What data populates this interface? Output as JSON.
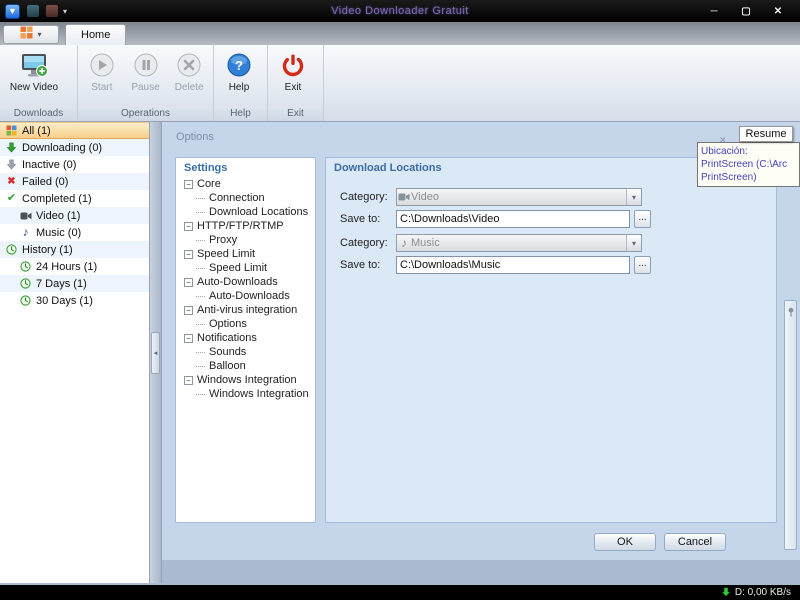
{
  "window": {
    "title": "Video Downloader Gratuit"
  },
  "ribbon": {
    "home_tab": "Home",
    "groups": [
      {
        "label": "Downloads",
        "buttons": [
          {
            "label": "New Video",
            "icon": "new-video-monitor-icon",
            "enabled": true
          }
        ]
      },
      {
        "label": "Operations",
        "buttons": [
          {
            "label": "Start",
            "icon": "play-circle-icon",
            "enabled": false
          },
          {
            "label": "Pause",
            "icon": "pause-circle-icon",
            "enabled": false
          },
          {
            "label": "Delete",
            "icon": "delete-circle-icon",
            "enabled": false
          }
        ]
      },
      {
        "label": "Help",
        "buttons": [
          {
            "label": "Help",
            "icon": "help-circle-icon",
            "enabled": true
          }
        ]
      },
      {
        "label": "Exit",
        "buttons": [
          {
            "label": "Exit",
            "icon": "power-icon",
            "enabled": true
          }
        ]
      }
    ]
  },
  "sidebar": {
    "items": [
      {
        "label": "All (1)",
        "icon": "categories-grid-icon",
        "indent": 0,
        "selected": true
      },
      {
        "label": "Downloading (0)",
        "icon": "download-arrow-green-icon",
        "indent": 0
      },
      {
        "label": "Inactive (0)",
        "icon": "download-arrow-gray-icon",
        "indent": 0
      },
      {
        "label": "Failed (0)",
        "icon": "failed-x-icon",
        "indent": 0
      },
      {
        "label": "Completed (1)",
        "icon": "completed-check-icon",
        "indent": 0
      },
      {
        "label": "Video (1)",
        "icon": "video-camera-icon",
        "indent": 1
      },
      {
        "label": "Music (0)",
        "icon": "music-note-icon",
        "indent": 1
      },
      {
        "label": "History (1)",
        "icon": "history-clock-icon",
        "indent": 0
      },
      {
        "label": "24 Hours (1)",
        "icon": "clock-icon",
        "indent": 1
      },
      {
        "label": "7 Days (1)",
        "icon": "clock-icon",
        "indent": 1
      },
      {
        "label": "30 Days (1)",
        "icon": "clock-icon",
        "indent": 1
      }
    ]
  },
  "options": {
    "panel_title": "Options",
    "settings": {
      "group_title": "Settings",
      "tree": [
        {
          "label": "Core",
          "level": 0
        },
        {
          "label": "Connection",
          "level": 1
        },
        {
          "label": "Download Locations",
          "level": 1
        },
        {
          "label": "HTTP/FTP/RTMP",
          "level": 0
        },
        {
          "label": "Proxy",
          "level": 1
        },
        {
          "label": "Speed Limit",
          "level": 0
        },
        {
          "label": "Speed Limit",
          "level": 1
        },
        {
          "label": "Auto-Downloads",
          "level": 0
        },
        {
          "label": "Auto-Downloads",
          "level": 1
        },
        {
          "label": "Anti-virus integration",
          "level": 0
        },
        {
          "label": "Options",
          "level": 1
        },
        {
          "label": "Notifications",
          "level": 0
        },
        {
          "label": "Sounds",
          "level": 1
        },
        {
          "label": "Balloon",
          "level": 1
        },
        {
          "label": "Windows Integration",
          "level": 0
        },
        {
          "label": "Windows Integration",
          "level": 1
        }
      ]
    },
    "download_locations": {
      "group_title": "Download Locations",
      "rows": [
        {
          "category_label": "Category:",
          "category_value": "Video",
          "category_icon": "video-camera-icon",
          "save_label": "Save to:",
          "save_value": "C:\\Downloads\\Video",
          "browse_label": "..."
        },
        {
          "category_label": "Category:",
          "category_value": "Music",
          "category_icon": "music-note-icon",
          "save_label": "Save to:",
          "save_value": "C:\\Downloads\\Music",
          "browse_label": "..."
        }
      ]
    },
    "ok_label": "OK",
    "cancel_label": "Cancel"
  },
  "overlay": {
    "resume_label": "Resume",
    "tooltip": {
      "line1": "Ubicación: PrintScreen (C:\\Arc",
      "line2": "PrintScreen)"
    }
  },
  "statusbar": {
    "download_speed": "D: 0,00 KB/s"
  },
  "colors": {
    "accent_blue": "#3a6ea5",
    "selection_orange": "#f6cf8a",
    "success_green": "#2e9e2e",
    "error_red": "#d43030",
    "exit_red": "#d62718"
  }
}
